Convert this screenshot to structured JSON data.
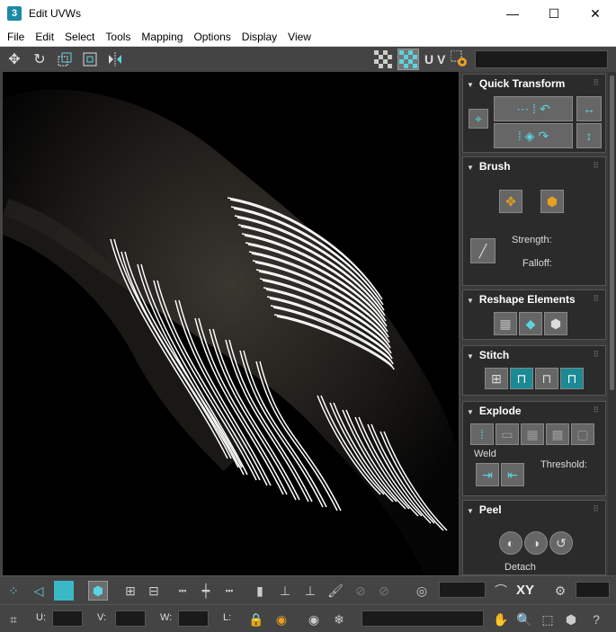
{
  "window": {
    "title": "Edit UVWs",
    "app_icon": "3",
    "controls": {
      "minimize": "—",
      "maximize": "☐",
      "close": "✕"
    }
  },
  "menu": [
    "File",
    "Edit",
    "Select",
    "Tools",
    "Mapping",
    "Options",
    "Display",
    "View"
  ],
  "toolbar": {
    "uv_label": "U V"
  },
  "panel": {
    "quick_transform": {
      "title": "Quick Transform"
    },
    "brush": {
      "title": "Brush",
      "strength_label": "Strength:",
      "falloff_label": "Falloff:"
    },
    "reshape": {
      "title": "Reshape Elements"
    },
    "stitch": {
      "title": "Stitch"
    },
    "explode": {
      "title": "Explode",
      "weld_label": "Weld",
      "threshold_label": "Threshold:"
    },
    "peel": {
      "title": "Peel",
      "detach_label": "Detach"
    }
  },
  "bottom": {
    "xy_label": "XY",
    "u_label": "U:",
    "v_label": "V:",
    "w_label": "W:",
    "l_label": "L:"
  },
  "colors": {
    "accent_teal": "#1a8a95",
    "icon_cyan": "#5bd4e0",
    "uv_lines": "#ffffff"
  },
  "icons": [
    "move-icon",
    "rotate-icon",
    "scale-icon",
    "freeform-icon",
    "mirror-icon",
    "checker-icon",
    "texture-icon",
    "settings-icon",
    "lock-icon",
    "eye-icon",
    "snowflake-icon",
    "hand-icon",
    "zoom-icon"
  ]
}
